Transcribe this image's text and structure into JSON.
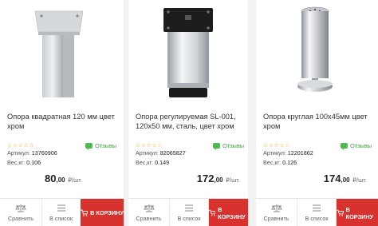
{
  "products": [
    {
      "title": "Опора квадратная 120 мм цвет хром",
      "rating_stars": "☆☆☆☆☆",
      "reviews_label": "Отзывы",
      "article_label": "Артикул:",
      "article": "13760906",
      "weight_label": "Вес,кг:",
      "weight": "0.106",
      "price_main": "80",
      "price_cents": ",00",
      "price_unit": "₽/шт.",
      "compare_label": "Сравнить",
      "list_label": "В список",
      "cart_label": "В КОРЗИНУ",
      "image_icon": "square-leg-image"
    },
    {
      "title": "Опора регулируемая SL-001, 120х50 мм, сталь, цвет хром",
      "rating_stars": "☆☆☆☆☆",
      "reviews_label": "Отзывы",
      "article_label": "Артикул:",
      "article": "82065827",
      "weight_label": "Вес,кг:",
      "weight": "0.149",
      "price_main": "172",
      "price_cents": ",00",
      "price_unit": "₽/шт.",
      "compare_label": "Сравнить",
      "list_label": "В список",
      "cart_label": "В КОРЗИНУ",
      "image_icon": "cylinder-leg-image"
    },
    {
      "title": "Опора круглая 100х45мм цвет хром",
      "rating_stars": "☆☆☆☆☆",
      "reviews_label": "Отзывы",
      "article_label": "Артикул:",
      "article": "12201862",
      "weight_label": "Вес,кг:",
      "weight": "0.126",
      "price_main": "174",
      "price_cents": ",00",
      "price_unit": "₽/шт.",
      "compare_label": "Сравнить",
      "list_label": "В список",
      "cart_label": "В КОРЗИНУ",
      "image_icon": "round-leg-image"
    }
  ],
  "colors": {
    "cart_button": "#d8322f",
    "reviews": "#3aa83a",
    "stars": "#e8a000"
  }
}
